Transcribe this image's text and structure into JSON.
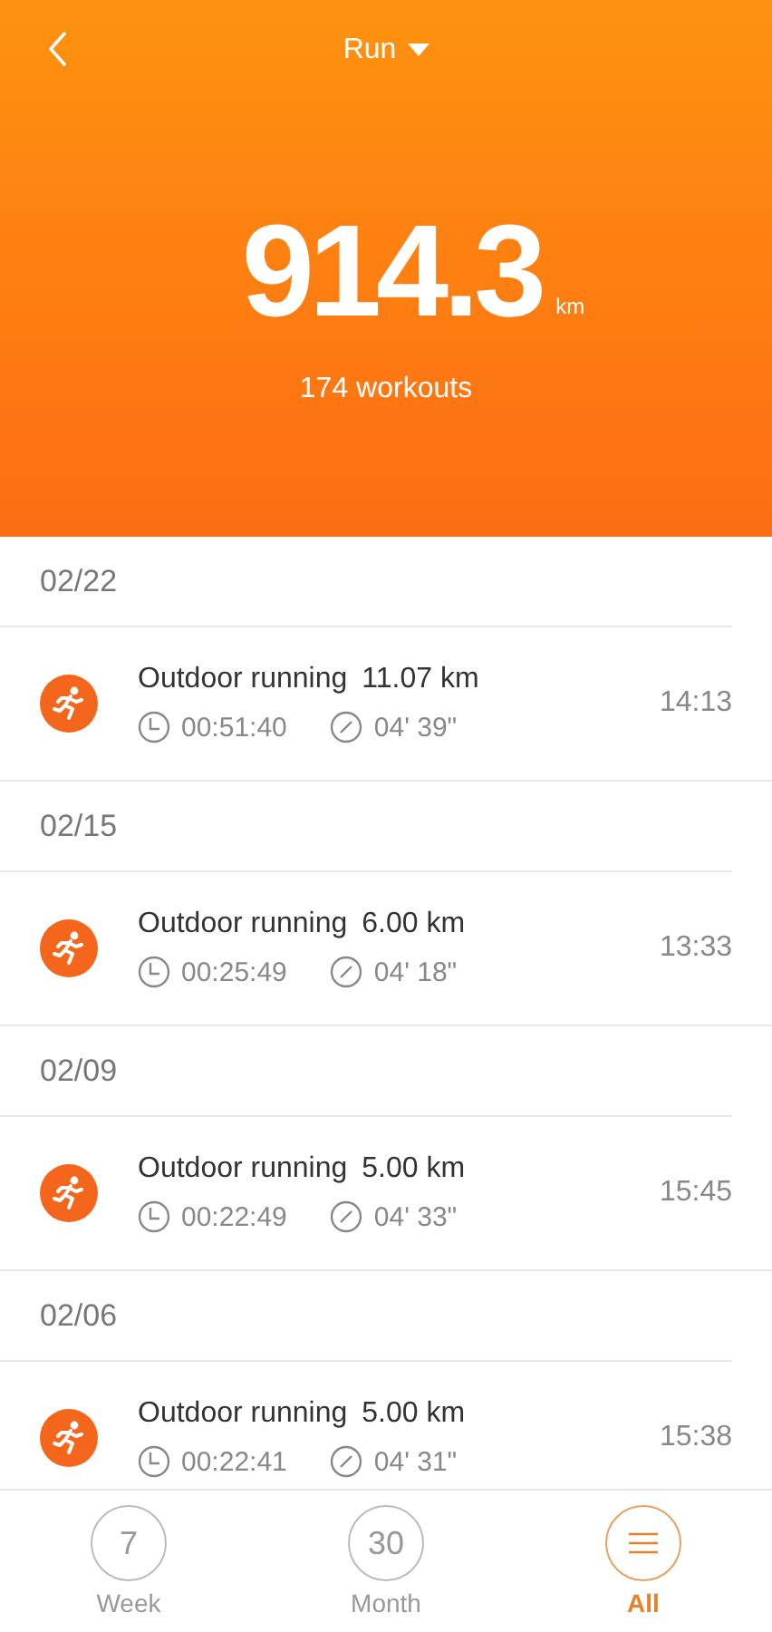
{
  "header": {
    "title": "Run",
    "total": "914.3",
    "unit": "km",
    "workouts": "174 workouts"
  },
  "groups": [
    {
      "date": "02/22",
      "items": [
        {
          "name": "Outdoor running",
          "distance": "11.07 km",
          "duration": "00:51:40",
          "pace": "04' 39\"",
          "time": "14:13"
        }
      ]
    },
    {
      "date": "02/15",
      "items": [
        {
          "name": "Outdoor running",
          "distance": "6.00 km",
          "duration": "00:25:49",
          "pace": "04' 18\"",
          "time": "13:33"
        }
      ]
    },
    {
      "date": "02/09",
      "items": [
        {
          "name": "Outdoor running",
          "distance": "5.00 km",
          "duration": "00:22:49",
          "pace": "04' 33\"",
          "time": "15:45"
        }
      ]
    },
    {
      "date": "02/06",
      "items": [
        {
          "name": "Outdoor running",
          "distance": "5.00 km",
          "duration": "00:22:41",
          "pace": "04' 31\"",
          "time": "15:38"
        }
      ]
    }
  ],
  "tabs": [
    {
      "kind": "number",
      "symbol": "7",
      "label": "Week",
      "selected": false
    },
    {
      "kind": "number",
      "symbol": "30",
      "label": "Month",
      "selected": false
    },
    {
      "kind": "icon",
      "label": "All",
      "selected": true
    }
  ]
}
